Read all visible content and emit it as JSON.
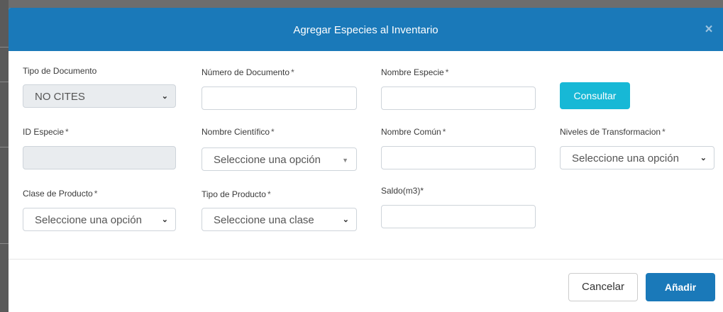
{
  "modal": {
    "title": "Agregar Especies al Inventario",
    "close_label": "×"
  },
  "form": {
    "tipo_documento": {
      "label": "Tipo de Documento",
      "value": "NO CITES"
    },
    "numero_documento": {
      "label": "Número de Documento",
      "required": "*",
      "value": ""
    },
    "nombre_especie": {
      "label": "Nombre Especie",
      "required": "*",
      "value": ""
    },
    "consultar_label": "Consultar",
    "id_especie": {
      "label": "ID Especie",
      "required": "*",
      "value": ""
    },
    "nombre_cientifico": {
      "label": "Nombre Científico",
      "required": "*",
      "value": "Seleccione una opción"
    },
    "nombre_comun": {
      "label": "Nombre Común",
      "required": "*",
      "value": ""
    },
    "niveles_transformacion": {
      "label": "Niveles de Transformacion",
      "required": "*",
      "value": "Seleccione una opción"
    },
    "clase_producto": {
      "label": "Clase de Producto",
      "required": "*",
      "value": "Seleccione una opción"
    },
    "tipo_producto": {
      "label": "Tipo de Producto",
      "required": "*",
      "value": "Seleccione una clase"
    },
    "saldo": {
      "label": "Saldo(m3)*",
      "value": ""
    }
  },
  "footer": {
    "cancel_label": "Cancelar",
    "add_label": "Añadir"
  },
  "icons": {
    "select_chevron": "chevron-down-icon",
    "select_caret": "caret-down-icon",
    "close": "close-icon"
  },
  "colors": {
    "header": "#1a79b9",
    "consultar": "#17b8d6",
    "add_button": "#1a79b9"
  }
}
